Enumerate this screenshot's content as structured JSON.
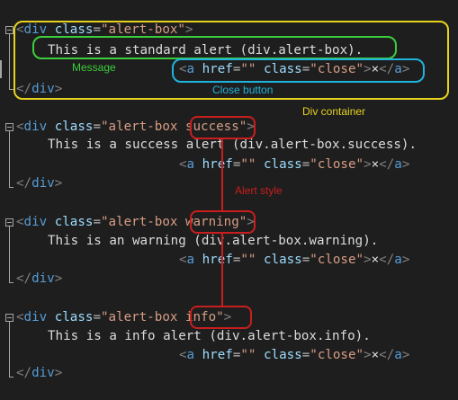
{
  "colors": {
    "background": "#1e1e1e",
    "tag": "#569cd6",
    "attribute": "#9cdcfe",
    "attribute_value": "#d69d85",
    "text": "#dcdcdc",
    "bracket": "#808080",
    "container_annotation": "#e6d21e",
    "message_annotation": "#3ccd3c",
    "close_annotation": "#1eb4dc",
    "style_annotation": "#c81e1e"
  },
  "blocks": [
    {
      "open": {
        "tag": "div",
        "attr": "class",
        "value": "alert-box"
      },
      "message": "This is a standard alert (div.alert-box).",
      "link": {
        "tag": "a",
        "attr1": "href",
        "value1": "",
        "attr2": "class",
        "value2": "close",
        "text": "×"
      },
      "close_tag": "div"
    },
    {
      "open": {
        "tag": "div",
        "attr": "class",
        "value_prefix": "alert-box ",
        "value_style": "success"
      },
      "message": "This is a success alert (div.alert-box.success).",
      "link": {
        "tag": "a",
        "attr1": "href",
        "value1": "",
        "attr2": "class",
        "value2": "close",
        "text": "×"
      },
      "close_tag": "div"
    },
    {
      "open": {
        "tag": "div",
        "attr": "class",
        "value_prefix": "alert-box ",
        "value_style": "warning"
      },
      "message": "This is an warning (div.alert-box.warning).",
      "link": {
        "tag": "a",
        "attr1": "href",
        "value1": "",
        "attr2": "class",
        "value2": "close",
        "text": "×"
      },
      "close_tag": "div"
    },
    {
      "open": {
        "tag": "div",
        "attr": "class",
        "value_prefix": "alert-box ",
        "value_style": "info"
      },
      "message": "This is a info alert (div.alert-box.info).",
      "link": {
        "tag": "a",
        "attr1": "href",
        "value1": "",
        "attr2": "class",
        "value2": "close",
        "text": "×"
      },
      "close_tag": "div"
    }
  ],
  "annotations": {
    "message_label": "Message",
    "close_button_label": "Close button",
    "div_container_label": "Div container",
    "alert_style_label": "Alert style"
  }
}
